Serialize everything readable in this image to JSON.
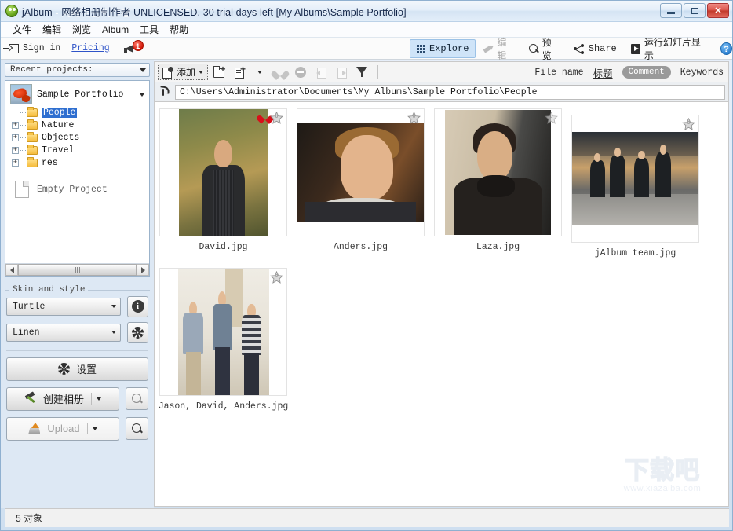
{
  "window": {
    "title": "jAlbum - 网络相册制作者 UNLICENSED. 30 trial days left [My Albums\\Sample Portfolio]",
    "minimize_label": "Minimize",
    "maximize_label": "Maximize",
    "close_label": "✕"
  },
  "menu": {
    "items": [
      {
        "label": "文件"
      },
      {
        "label": "编辑"
      },
      {
        "label": "浏览"
      },
      {
        "label": "Album"
      },
      {
        "label": "工具"
      },
      {
        "label": "帮助"
      }
    ]
  },
  "account": {
    "sign_in": "Sign in",
    "pricing": "Pricing",
    "notification_count": "1"
  },
  "modes": {
    "items": [
      {
        "label": "Explore",
        "icon": "grid-icon",
        "state": "active"
      },
      {
        "label": "编辑",
        "icon": "pencil-icon",
        "state": "disabled"
      },
      {
        "label": "预览",
        "icon": "magnifier-icon",
        "state": "normal"
      },
      {
        "label": "Share",
        "icon": "share-icon",
        "state": "normal"
      },
      {
        "label": "运行幻灯片显示",
        "icon": "play-icon",
        "state": "normal"
      }
    ],
    "help_label": "?"
  },
  "sidebar": {
    "recent_projects_label": "Recent projects:",
    "project": {
      "name": "Sample Portfolio",
      "tree": [
        {
          "label": "People",
          "expander": "",
          "selected": true
        },
        {
          "label": "Nature",
          "expander": "+",
          "selected": false
        },
        {
          "label": "Objects",
          "expander": "+",
          "selected": false
        },
        {
          "label": "Travel",
          "expander": "+",
          "selected": false
        },
        {
          "label": "res",
          "expander": "+",
          "selected": false
        }
      ]
    },
    "empty_project_label": "Empty Project",
    "skin_group_label": "Skin and style",
    "skin_value": "Turtle",
    "style_value": "Linen",
    "info_label": "i",
    "settings_button": "设置",
    "make_album_button": "创建相册",
    "upload_button": "Upload"
  },
  "toolbar": {
    "add_label": "添加",
    "icons": [
      {
        "name": "new-folder-icon"
      },
      {
        "name": "new-list-icon"
      },
      {
        "name": "favorite-heart-icon"
      },
      {
        "name": "exclude-icon"
      },
      {
        "name": "rotate-left-icon"
      },
      {
        "name": "rotate-right-icon"
      },
      {
        "name": "filter-funnel-icon"
      }
    ],
    "sort_fields": [
      {
        "label": "File name",
        "style": "plain"
      },
      {
        "label": "标题",
        "style": "underline"
      },
      {
        "label": "Comment",
        "style": "pill"
      },
      {
        "label": "Keywords",
        "style": "plain"
      }
    ]
  },
  "path_bar": {
    "path": "C:\\Users\\Administrator\\Documents\\My Albums\\Sample Portfolio\\People",
    "up_label": "Up"
  },
  "grid": {
    "items": [
      {
        "caption": "David.jpg",
        "art": "p-david",
        "flagged": true,
        "frame_kind": "portrait"
      },
      {
        "caption": "Anders.jpg",
        "art": "p-anders",
        "flagged": false,
        "frame_kind": "landscape"
      },
      {
        "caption": "Laza.jpg",
        "art": "p-laza",
        "flagged": false,
        "frame_kind": "wide-portrait"
      },
      {
        "caption": "jAlbum team.jpg",
        "art": "p-team",
        "flagged": false,
        "frame_kind": "landscape"
      },
      {
        "caption": "Jason, David, Anders.jpg",
        "art": "p-three",
        "flagged": false,
        "frame_kind": "portrait"
      }
    ]
  },
  "status": {
    "object_count": "5 对象"
  },
  "watermark": {
    "main": "下载吧",
    "sub": "www.xiazaiba.com"
  },
  "colors": {
    "accent": "#2f6fd0",
    "selection": "#cfe4f8",
    "link": "#2f54c8",
    "badge": "#d31b0b",
    "flag": "#d8101a"
  }
}
